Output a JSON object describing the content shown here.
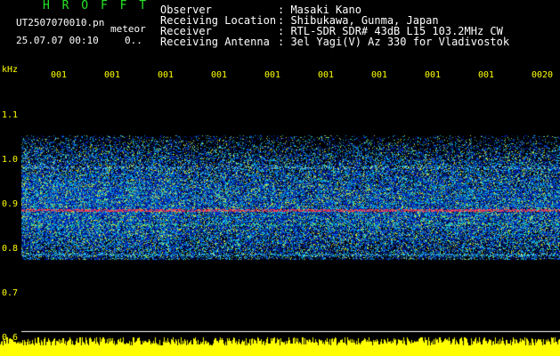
{
  "header": {
    "app_title": "H R O F F T",
    "filename": "UT2507070010.pn",
    "event_label": "meteor",
    "datetime": "25.07.07 00:10",
    "counter": "0.."
  },
  "info": [
    {
      "label": "Observer",
      "value": ": Masaki Kano"
    },
    {
      "label": "Receiving Location",
      "value": ": Shibukawa, Gunma, Japan"
    },
    {
      "label": "Receiver",
      "value": ": RTL-SDR SDR# 43dB L15 103.2MHz CW"
    },
    {
      "label": "Receiving Antenna",
      "value": ": 3el Yagi(V) Az 330 for Vladivostok"
    }
  ],
  "axis": {
    "unit": "kHz",
    "y_ticks": [
      "1.1",
      "1.0",
      "0.9",
      "0.8",
      "0.7",
      "0.6"
    ],
    "x_ticks": [
      "001",
      "001",
      "001",
      "001",
      "001",
      "001",
      "001",
      "001",
      "001",
      "0020"
    ]
  },
  "colors": {
    "background": "#000000",
    "title": "#26e626",
    "axis_text": "#ffff00",
    "info_text": "#ffffff"
  }
}
